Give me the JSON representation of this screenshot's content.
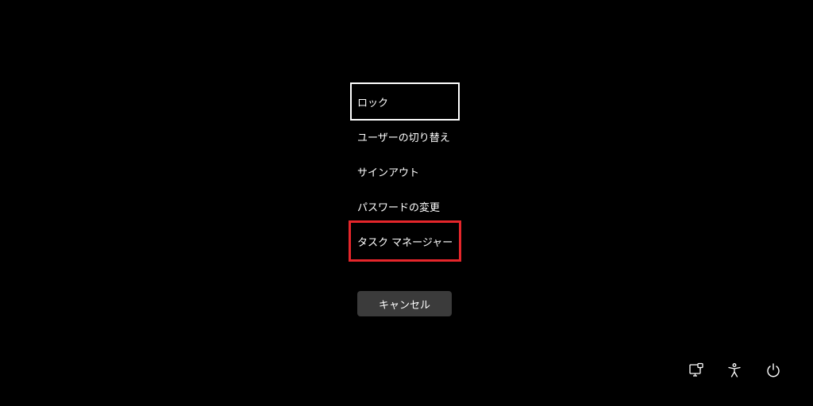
{
  "menu": {
    "items": [
      {
        "label": "ロック"
      },
      {
        "label": "ユーザーの切り替え"
      },
      {
        "label": "サインアウト"
      },
      {
        "label": "パスワードの変更"
      },
      {
        "label": "タスク マネージャー"
      }
    ]
  },
  "cancel": {
    "label": "キャンセル"
  },
  "tray": {
    "icons": [
      "network-icon",
      "accessibility-icon",
      "power-icon"
    ]
  },
  "colors": {
    "background": "#000000",
    "highlight": "#e5262b",
    "button": "#3b3b3b"
  }
}
